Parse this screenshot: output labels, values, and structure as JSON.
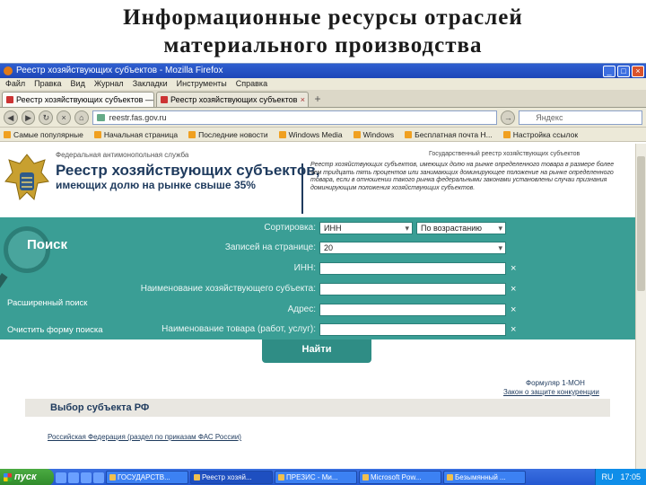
{
  "slide": {
    "title_line1": "Информационные ресурсы отраслей",
    "title_line2": "материального производства"
  },
  "browser": {
    "window_title": "Реестр хозяйствующих субъектов - Mozilla Firefox",
    "menu": [
      "Файл",
      "Правка",
      "Вид",
      "Журнал",
      "Закладки",
      "Инструменты",
      "Справка"
    ],
    "tabs": [
      {
        "label": "Реестр хозяйствующих субъектов — ...",
        "active": true
      },
      {
        "label": "Реестр хозяйствующих субъектов",
        "active": false
      }
    ],
    "url": "reestr.fas.gov.ru",
    "search_placeholder": "Яндекс",
    "bookmarks": [
      "Самые популярные",
      "Начальная страница",
      "Последние новости",
      "Windows Media",
      "Windows",
      "Бесплатная почта H...",
      "Настройка ссылок"
    ]
  },
  "header": {
    "agency": "Федеральная антимонопольная служба",
    "title": "Реестр хозяйствующих субъектов,",
    "subtitle": "имеющих долю на рынке свыше 35%",
    "meta": "Государственный реестр хозяйствующих субъектов",
    "description": "Реестр хозяйствующих субъектов, имеющих долю на рынке определенного товара в размере более чем тридцать пять процентов или занимающих доминирующее положение на рынке определенного товара, если в отношении такого рынка федеральными законами установлены случаи признания доминирующим положения хозяйствующих субъектов."
  },
  "search": {
    "heading": "Поиск",
    "sort_label": "Сортировка:",
    "sort_field": "ИНН",
    "sort_order": "По возрастанию",
    "per_page_label": "Записей на странице:",
    "per_page": "20",
    "inn_label": "ИНН:",
    "name_label": "Наименование хозяйствующего субъекта:",
    "address_label": "Адрес:",
    "goods_label": "Наименование товара (работ, услуг):",
    "clear_glyph": "×",
    "advanced": "Расширенный поиск",
    "clear_form": "Очистить форму поиска",
    "find_button": "Найти"
  },
  "links": {
    "form": "Формуляр 1-МОН",
    "law": "Закон о защите конкуренции"
  },
  "subject": {
    "heading": "Выбор субъекта РФ",
    "rf_link": "Российская Федерация (раздел по приказам ФАС России)"
  },
  "taskbar": {
    "start": "пуск",
    "tasks": [
      "ГОСУДАРСТВ...",
      "Реестр хозяй...",
      "ПРЕЗИС - Ми...",
      "Microsoft Pow...",
      "Безымянный ..."
    ],
    "lang": "RU",
    "time": "17:05"
  }
}
